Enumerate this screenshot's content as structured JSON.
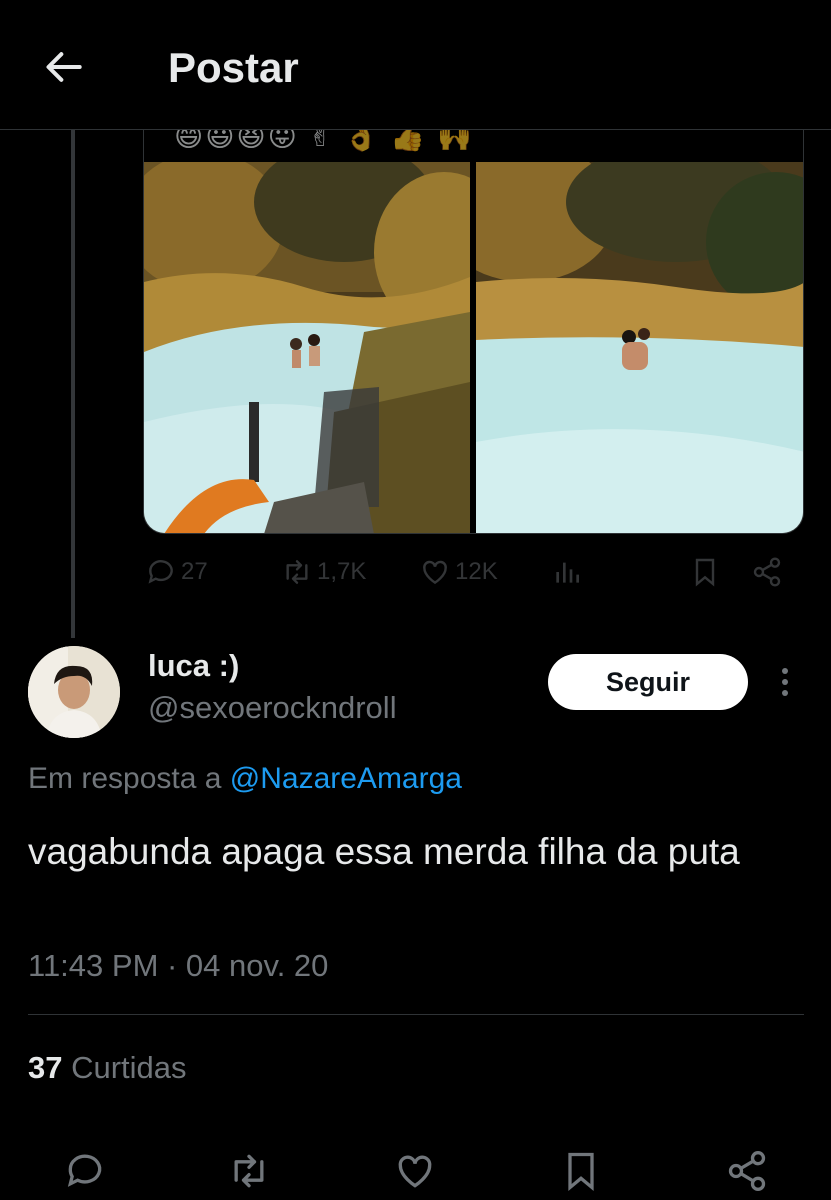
{
  "header": {
    "title": "Postar",
    "back_icon": "arrow-left-icon"
  },
  "parent_tweet": {
    "emoji_strip": "😄😃😆😛 ✌ 👌 👍 🙌",
    "stats": {
      "replies": "27",
      "retweets": "1,7K",
      "likes": "12K"
    }
  },
  "reply": {
    "display_name": "luca :)",
    "handle": "@sexoerockndroll",
    "follow_label": "Seguir",
    "reply_prefix": "Em resposta a",
    "reply_mention": "@NazareAmarga",
    "text": "vagabunda apaga essa merda filha da puta",
    "timestamp": "11:43 PM · 04 nov. 20",
    "likes_count": "37",
    "likes_label": "Curtidas"
  },
  "colors": {
    "background": "#000000",
    "text": "#e7e9ea",
    "secondary": "#71767b",
    "accent": "#1d9bf0",
    "divider": "#2f3336"
  }
}
